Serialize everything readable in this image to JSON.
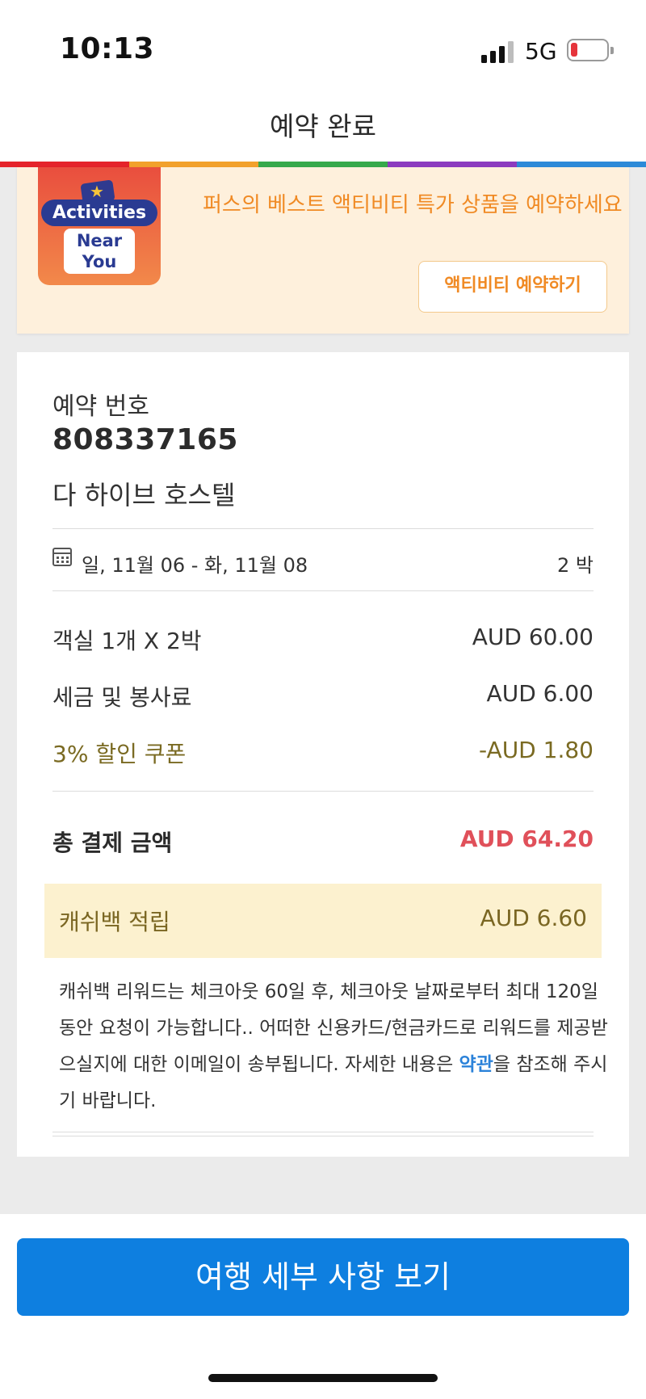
{
  "status_bar": {
    "time": "10:13",
    "network": "5G"
  },
  "header": {
    "title": "예약 완료",
    "rainbow_colors": [
      "#e5232b",
      "#f2a12c",
      "#36a94b",
      "#8c3bbf",
      "#2d8ad8"
    ]
  },
  "promo": {
    "logo_line1": "Activities",
    "logo_line2": "Near",
    "logo_line3": "You",
    "message": "퍼스의 베스트 액티비티 특가 상품을 예약하세요",
    "button_label": "액티비티 예약하기"
  },
  "booking": {
    "number_label": "예약 번호",
    "number": "808337165",
    "hotel_name": "다 하이브 호스텔",
    "dates": "일, 11월 06 - 화, 11월 08",
    "nights": "2 박",
    "room_label": "객실 1개 X 2박",
    "room_price": "AUD 60.00",
    "tax_label": "세금 및 봉사료",
    "tax_price": "AUD 6.00",
    "coupon_label": "3% 할인 쿠폰",
    "coupon_price": "-AUD 1.80",
    "total_label": "총 결제 금액",
    "total_price": "AUD 64.20",
    "cashback_label": "캐쉬백 적립",
    "cashback_amount": "AUD 6.60",
    "note_before_link": "캐쉬백 리워드는 체크아웃 60일 후, 체크아웃 날짜로부터 최대 120일 동안 요청이 가능합니다.. 어떠한 신용카드/현금카드로 리워드를 제공받으실지에 대한 이메일이 송부됩니다. 자세한 내용은 ",
    "note_link": "약관",
    "note_after_link": "을 참조해 주시기 바랍니다."
  },
  "footer": {
    "button_label": "여행 세부 사항 보기"
  }
}
